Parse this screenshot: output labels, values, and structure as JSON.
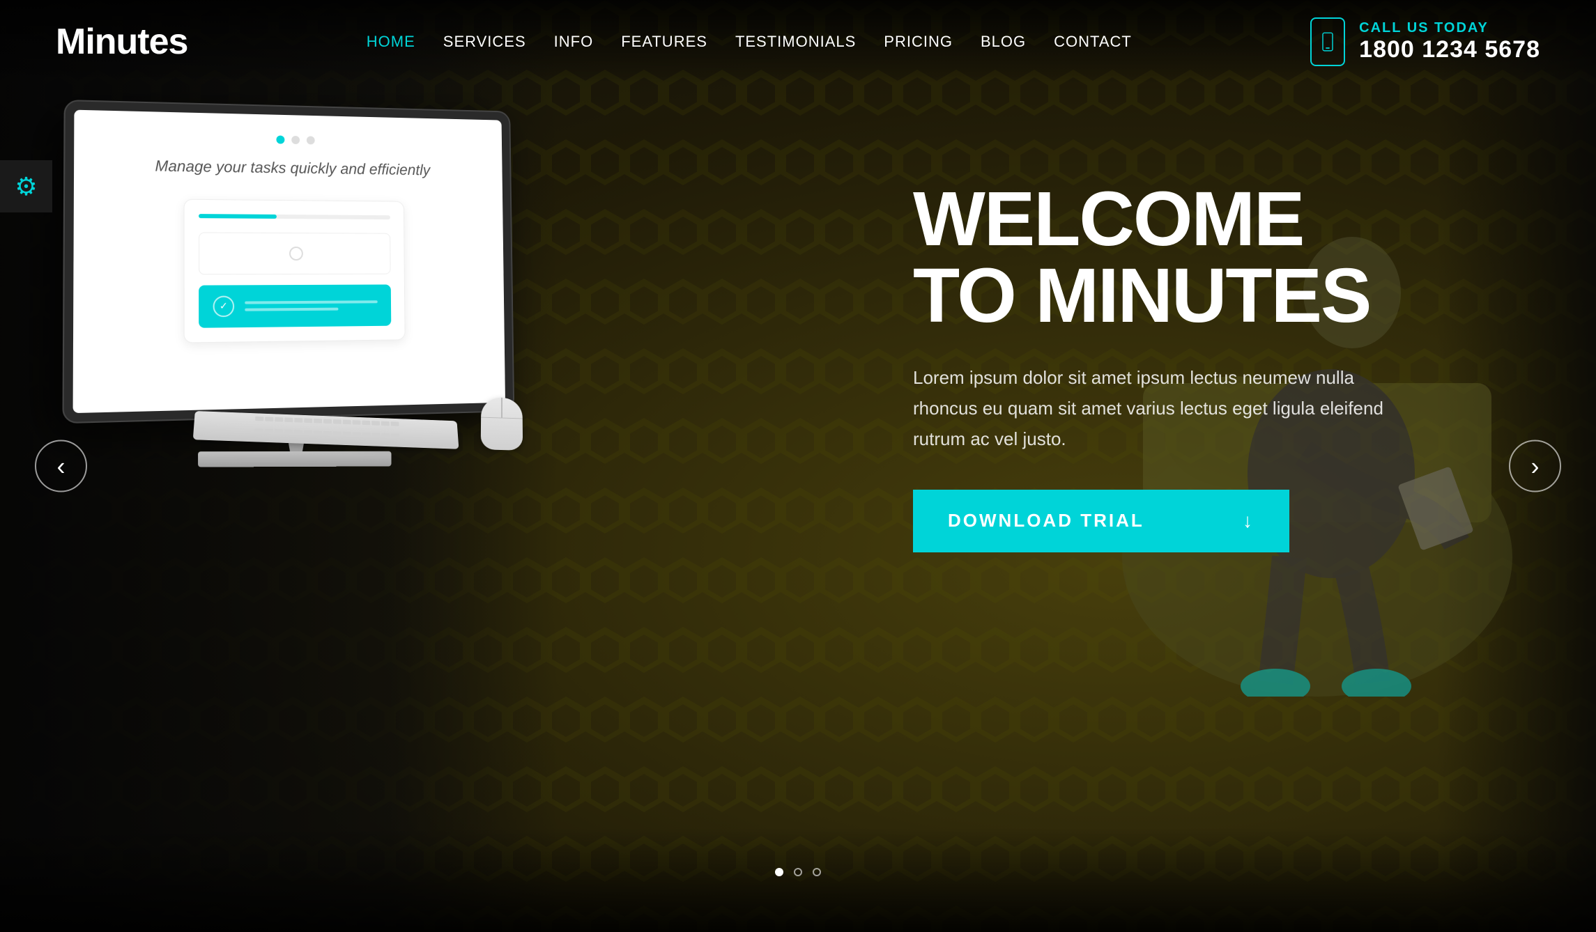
{
  "logo": {
    "text": "Minutes"
  },
  "nav": {
    "items": [
      {
        "label": "HOME",
        "active": true
      },
      {
        "label": "SERVICES",
        "active": false
      },
      {
        "label": "INFO",
        "active": false
      },
      {
        "label": "FEATURES",
        "active": false
      },
      {
        "label": "TESTIMONIALS",
        "active": false
      },
      {
        "label": "PRICING",
        "active": false
      },
      {
        "label": "BLOG",
        "active": false
      },
      {
        "label": "CONTACT",
        "active": false
      }
    ]
  },
  "header": {
    "call_label": "CALL US TODAY",
    "phone": "1800 1234 5678"
  },
  "hero": {
    "title_line1": "WELCOME",
    "title_line2": "TO MINUTES",
    "description": "Lorem ipsum dolor sit amet ipsum lectus neumew nulla rhoncus eu quam sit amet varius lectus eget ligula eleifend\nrutrum ac vel justo.",
    "download_btn": "DOWNLOAD TRIAL"
  },
  "monitor": {
    "slide_text": "Manage your tasks quickly\nand efficiently"
  },
  "arrows": {
    "left": "‹",
    "right": "›"
  },
  "icons": {
    "gear": "⚙",
    "download": "↓",
    "phone": "📱",
    "check": "✓"
  },
  "colors": {
    "accent": "#00d4d8",
    "bg_dark": "#1a1a1a",
    "text_white": "#ffffff"
  }
}
